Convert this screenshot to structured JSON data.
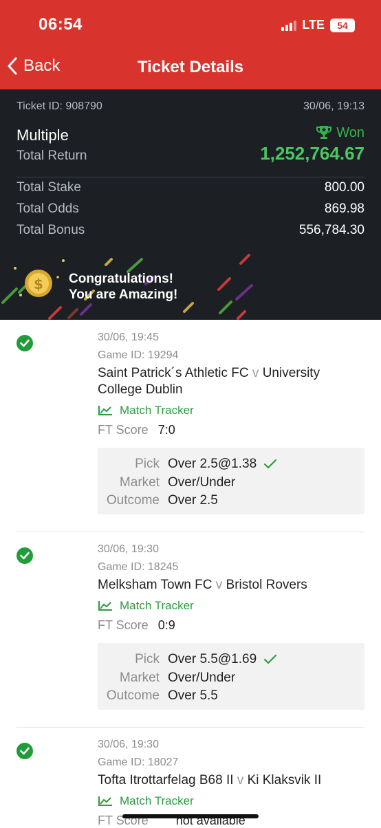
{
  "status_bar": {
    "time": "06:54",
    "network": "LTE",
    "battery": "54"
  },
  "nav": {
    "back_label": "Back",
    "title": "Ticket Details"
  },
  "summary": {
    "ticket_id": "Ticket ID: 908790",
    "datetime": "30/06, 19:13",
    "bet_type": "Multiple",
    "status": "Won",
    "total_return_label": "Total Return",
    "total_return": "1,252,764.67",
    "rows": [
      {
        "label": "Total Stake",
        "value": "800.00"
      },
      {
        "label": "Total Odds",
        "value": "869.98"
      },
      {
        "label": "Total Bonus",
        "value": "556,784.30"
      }
    ],
    "congrats_line1": "Congratulations!",
    "congrats_line2": "You are Amazing!"
  },
  "bets": [
    {
      "datetime": "30/06, 19:45",
      "game_id": "Game ID: 19294",
      "home": "Saint Patrick´s Athletic FC",
      "vs": "v",
      "away_line1": "University",
      "away_line2": "College Dublin",
      "tracker": "Match Tracker",
      "ft_label": "FT Score",
      "ft_score": "7:0",
      "pick_label": "Pick",
      "pick": "Over 2.5@1.38",
      "market_label": "Market",
      "market": "Over/Under",
      "outcome_label": "Outcome",
      "outcome": "Over 2.5"
    },
    {
      "datetime": "30/06, 19:30",
      "game_id": "Game ID: 18245",
      "home": "Melksham Town FC",
      "vs": "v",
      "away": "Bristol Rovers",
      "tracker": "Match Tracker",
      "ft_label": "FT Score",
      "ft_score": "0:9",
      "pick_label": "Pick",
      "pick": "Over 5.5@1.69",
      "market_label": "Market",
      "market": "Over/Under",
      "outcome_label": "Outcome",
      "outcome": "Over 5.5"
    },
    {
      "datetime": "30/06, 19:30",
      "game_id": "Game ID: 18027",
      "home": "Tofta Itrottarfelag B68 II",
      "vs": "v",
      "away": "Ki Klaksvik II",
      "tracker": "Match Tracker",
      "ft_label": "FT Score",
      "ft_score": "not available"
    }
  ],
  "colors": {
    "header": "#d9332d",
    "summary_bg": "#1c1f24",
    "won_green": "#33b64a",
    "return_green": "#4cc760",
    "tracker_green": "#2a9c3f"
  },
  "icons": [
    "chevron-left-icon",
    "signal-icon",
    "battery-icon",
    "trophy-icon",
    "coin-icon",
    "check-circle-icon",
    "chart-line-icon",
    "checkmark-icon"
  ]
}
